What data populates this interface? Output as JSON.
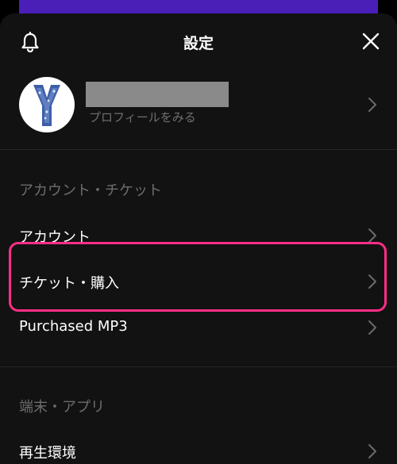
{
  "header": {
    "title": "設定",
    "bell_icon": "bell-icon",
    "close_icon": "close-icon"
  },
  "profile": {
    "subtitle": "プロフィールをみる"
  },
  "sections": [
    {
      "header": "アカウント・チケット",
      "items": [
        {
          "label": "アカウント"
        },
        {
          "label": "チケット・購入"
        },
        {
          "label": "Purchased MP3"
        }
      ]
    },
    {
      "header": "端末・アプリ",
      "items": [
        {
          "label": "再生環境"
        }
      ]
    }
  ],
  "colors": {
    "background": "#121212",
    "highlight": "#ff2e86",
    "banner": "#4a1fb8",
    "muted_text": "#6d6d6d"
  }
}
